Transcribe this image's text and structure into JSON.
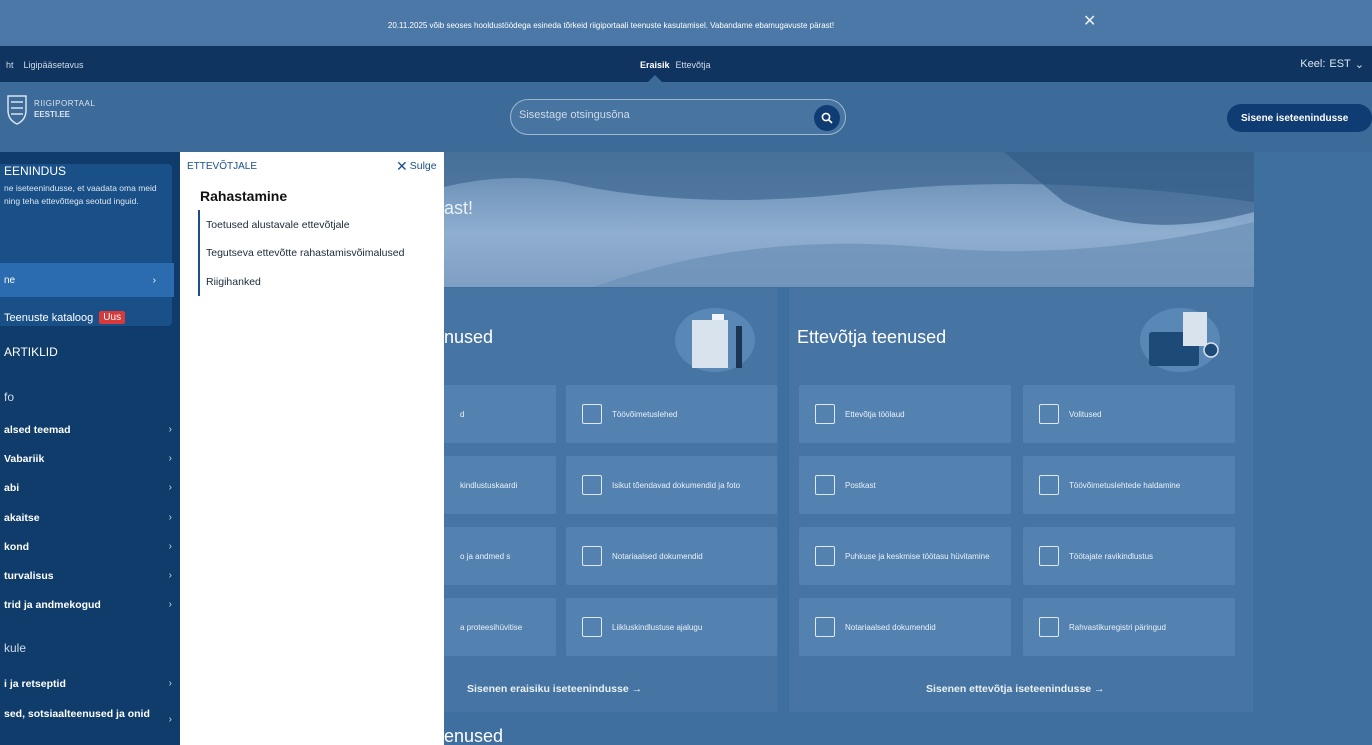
{
  "banner": {
    "text": "20.11.2025 võib seoses hooldustöödega esineda tõrkeid riigiportaali teenuste kasutamisel. Vabandame ebamugavuste pärast!"
  },
  "topnav": {
    "left_links": [
      "ht",
      "Ligipääsetavus"
    ],
    "center_tabs": [
      {
        "label": "Eraisik",
        "active": true
      },
      {
        "label": "Ettevõtja",
        "active": false
      }
    ],
    "lang_label": "Keel:",
    "lang_value": "EST"
  },
  "header": {
    "logo_line1": "RIIGIPORTAAL",
    "logo_line2": "EESTI.EE",
    "search_placeholder": "Sisestage otsingusõna",
    "enter_button": "Sisene iseteenindusse"
  },
  "sidebar": {
    "heading": "EENINDUS",
    "description": "ne iseteenindusse, et vaadata oma meid ning teha ettevõttega seotud inguid.",
    "enter_button": "ne",
    "catalog_label": "Teenuste kataloog",
    "catalog_badge": "Uus",
    "articles_heading": "ARTIKLID",
    "group1": "fo",
    "items1": [
      "alsed teemad",
      "Vabariik",
      "abi",
      "akaitse",
      "kond",
      "turvalisus",
      "trid ja andmekogud"
    ],
    "group2": "kule",
    "items2": [
      "i ja retseptid",
      "sed, sotsiaalteenused ja onid"
    ]
  },
  "panel": {
    "label": "ETTEVÕTJALE",
    "close": "Sulge",
    "title": "Rahastamine",
    "links": [
      "Toetused alustavale ettevõtjale",
      "Tegutseva ettevõtte rahastamisvõimalused",
      "Riigihanked"
    ]
  },
  "main": {
    "hero_text": "ast!",
    "private_heading": "nused",
    "business_heading": "Ettevõtja teenused",
    "private_cards": [
      "d",
      "Töövõimetuslehed",
      "kindlustuskaardi",
      "Isikut tõendavad dokumendid ja foto",
      "o ja andmed s",
      "Notariaalsed dokumendid",
      "a proteesihüvitise",
      "Liikluskindlustuse ajalugu"
    ],
    "business_cards": [
      "Ettevõtja töölaud",
      "Volitused",
      "Postkast",
      "Töövõimetuslehtede haldamine",
      "Puhkuse ja keskmise töötasu hüvitamine",
      "Töötajate ravikindlustus",
      "Notariaalsed dokumendid",
      "Rahvastikuregistri päringud"
    ],
    "private_cta": "Sisenen eraisiku iseteenindusse →",
    "business_cta": "Sisenen ettevõtja iseteenindusse →",
    "bottom_heading": "enused"
  }
}
